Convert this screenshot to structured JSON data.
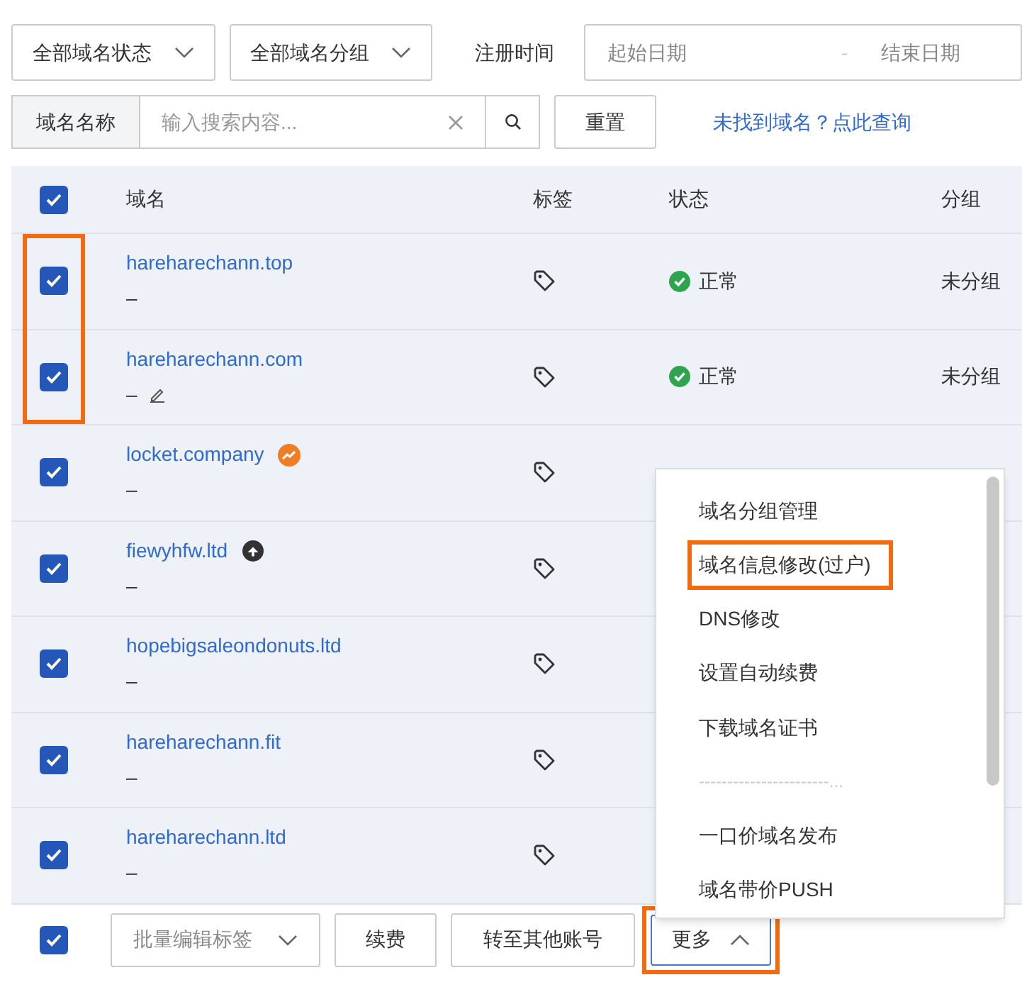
{
  "filters": {
    "status_select": "全部域名状态",
    "group_select": "全部域名分组",
    "date_label": "注册时间",
    "start_placeholder": "起始日期",
    "range_separator": "-",
    "end_placeholder": "结束日期"
  },
  "search": {
    "addon": "域名名称",
    "placeholder": "输入搜索内容...",
    "reset": "重置",
    "link": "未找到域名？点此查询"
  },
  "table": {
    "all_checked": true,
    "columns": [
      "域名",
      "标签",
      "状态",
      "分组"
    ],
    "rows": [
      {
        "name": "hareharechann.top",
        "note": "–",
        "editable": false,
        "checked": true,
        "highlighted": true,
        "status": "正常",
        "group": "未分组"
      },
      {
        "name": "hareharechann.com",
        "note": "–",
        "editable": true,
        "checked": true,
        "highlighted": true,
        "status": "正常",
        "group": "未分组"
      },
      {
        "name": "locket.company",
        "note": "–",
        "badge": {
          "kind": "trend"
        },
        "editable": false,
        "checked": true,
        "highlighted": false
      },
      {
        "name": "fiewyhfw.ltd",
        "note": "–",
        "badge": {
          "kind": "dark"
        },
        "editable": false,
        "checked": true,
        "highlighted": false
      },
      {
        "name": "hopebigsaleondonuts.ltd",
        "note": "–",
        "editable": false,
        "checked": true,
        "highlighted": false
      },
      {
        "name": "hareharechann.fit",
        "note": "–",
        "editable": false,
        "checked": true,
        "highlighted": false
      },
      {
        "name": "hareharechann.ltd",
        "note": "–",
        "editable": false,
        "checked": true,
        "highlighted": false
      }
    ]
  },
  "bottom_bar": {
    "checked": true,
    "tag_select": "批量编辑标签",
    "renew": "续费",
    "transfer": "转至其他账号",
    "more": "更多",
    "more_expanded": true,
    "more_highlighted": true
  },
  "menu": {
    "items": [
      {
        "kind": "item",
        "label": "域名分组管理",
        "highlighted": false
      },
      {
        "kind": "item",
        "label": "域名信息修改(过户)",
        "highlighted": true
      },
      {
        "kind": "item",
        "label": "DNS修改",
        "highlighted": false
      },
      {
        "kind": "item",
        "label": "设置自动续费",
        "highlighted": false
      },
      {
        "kind": "item",
        "label": "下载域名证书",
        "highlighted": false
      },
      {
        "kind": "separator",
        "label": "-----------------------..."
      },
      {
        "kind": "item",
        "label": "一口价域名发布",
        "highlighted": false
      },
      {
        "kind": "item",
        "label": "域名带价PUSH",
        "highlighted": false
      }
    ]
  }
}
